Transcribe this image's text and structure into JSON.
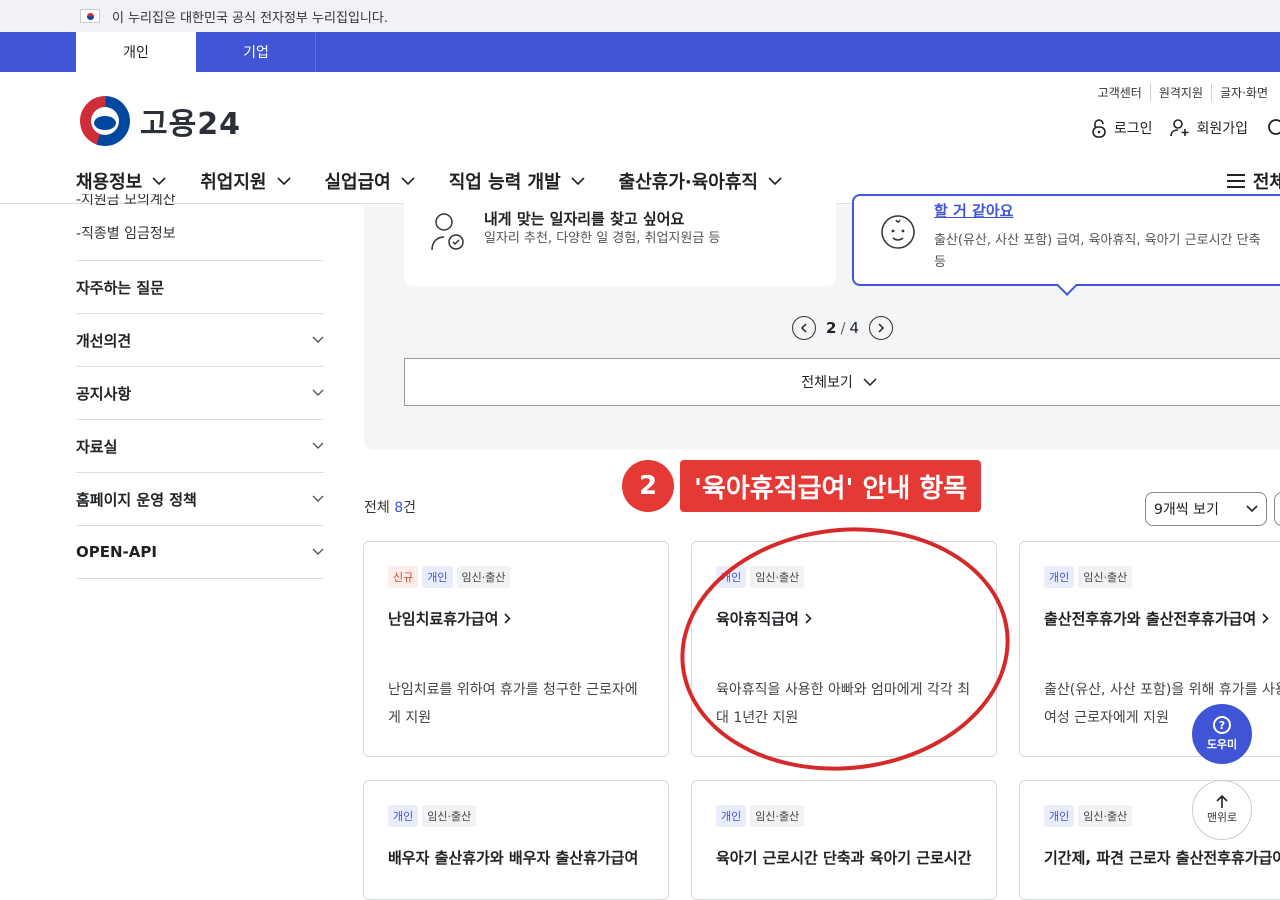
{
  "gov_banner": {
    "text": "이 누리집은 대한민국 공식 전자정부 누리집입니다."
  },
  "tabs": [
    {
      "label": "개인"
    },
    {
      "label": "기업"
    }
  ],
  "logo": {
    "text": "고용24"
  },
  "util_links": [
    "고객센터",
    "원격지원",
    "글자·화면"
  ],
  "user_links": {
    "login": "로그인",
    "signup": "회원가입"
  },
  "gnb": [
    "채용정보",
    "취업지원",
    "실업급여",
    "직업 능력 개발",
    "출산휴가·육아휴직"
  ],
  "menu_all": "전체",
  "sidebar": {
    "sub_items": [
      "-지원금 모의계산",
      "-직종별 임금정보"
    ],
    "items": [
      "자주하는 질문",
      "개선의견",
      "공지사항",
      "자료실",
      "홈페이지 운영 정책",
      "OPEN-API"
    ]
  },
  "topic_cards": [
    {
      "title": "내게 맞는 일자리를 찾고 싶어요",
      "desc": "일자리 추천, 다양한 일 경험, 취업지원금 등"
    },
    {
      "title": "할 거 같아요",
      "desc": "출산(유산, 사산 포함) 급여, 육아휴직, 육아기 근로시간 단축 등"
    }
  ],
  "pager": {
    "current": "2",
    "sep": "/",
    "total": "4"
  },
  "view_all": "전체보기",
  "annotation": {
    "number": "2",
    "label": "'육아휴직급여' 안내 항목"
  },
  "results": {
    "prefix": "전체",
    "count": "8",
    "suffix": "건",
    "per_page": "9개씩 보기"
  },
  "cards": [
    {
      "tags": [
        "신규",
        "개인",
        "임신·출산"
      ],
      "title": "난임치료휴가급여",
      "desc": "난임치료를 위하여 휴가를 청구한 근로자에게 지원"
    },
    {
      "tags": [
        "개인",
        "임신·출산"
      ],
      "title": "육아휴직급여",
      "desc": "육아휴직을 사용한 아빠와 엄마에게 각각 최대 1년간 지원"
    },
    {
      "tags": [
        "개인",
        "임신·출산"
      ],
      "title": "출산전후휴가와 출산전후휴가급여",
      "desc": "출산(유산, 사산 포함)을 위해 휴가를 사용한 여성 근로자에게 지원"
    },
    {
      "tags": [
        "개인",
        "임신·출산"
      ],
      "title": "배우자 출산휴가와 배우자 출산휴가급여",
      "desc": ""
    },
    {
      "tags": [
        "개인",
        "임신·출산"
      ],
      "title": "육아기 근로시간 단축과 육아기 근로시간",
      "desc": ""
    },
    {
      "tags": [
        "개인",
        "임신·출산"
      ],
      "title": "기간제, 파견 근로자 출산전후휴가급여",
      "desc": ""
    }
  ],
  "float": {
    "help": "도우미",
    "top": "맨위로"
  },
  "colors": {
    "brand": "#3f55d6",
    "annotation": "#e53935"
  }
}
